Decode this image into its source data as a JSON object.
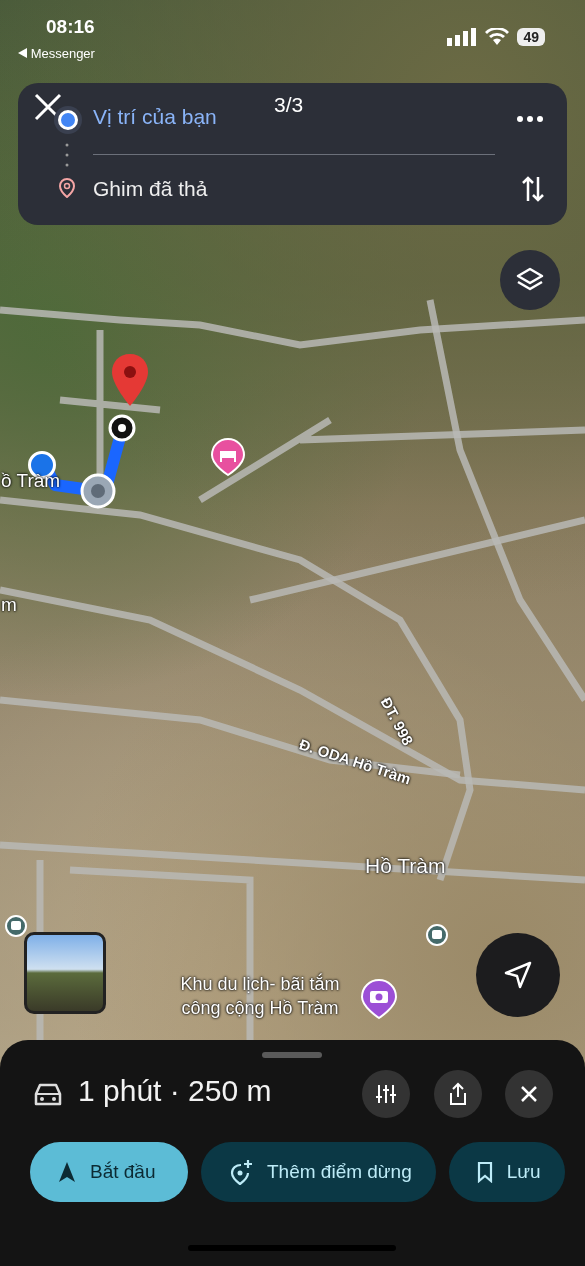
{
  "status_bar": {
    "time": "08:16",
    "back_label": "Messenger",
    "battery": "49"
  },
  "route_card": {
    "counter": "3/3",
    "origin": "Vị trí của bạn",
    "destination": "Ghim đã thả"
  },
  "map": {
    "labels": [
      {
        "text": "ồ Tràm",
        "kind": "place"
      },
      {
        "text": "m",
        "kind": "place"
      },
      {
        "text": "ĐT. 998",
        "kind": "road"
      },
      {
        "text": "Đ. ODA Hồ Tràm",
        "kind": "road"
      },
      {
        "text": "Hồ Tràm",
        "kind": "place"
      },
      {
        "text": "Khu du lịch- bãi tắm công cộng Hồ Tràm",
        "kind": "poi"
      }
    ]
  },
  "trip": {
    "summary": "1 phút · 250 m"
  },
  "actions": [
    {
      "label": "Bắt đầu",
      "kind": "primary"
    },
    {
      "label": "Thêm điểm dừng",
      "kind": "secondary"
    },
    {
      "label": "Lưu",
      "kind": "secondary"
    }
  ]
}
